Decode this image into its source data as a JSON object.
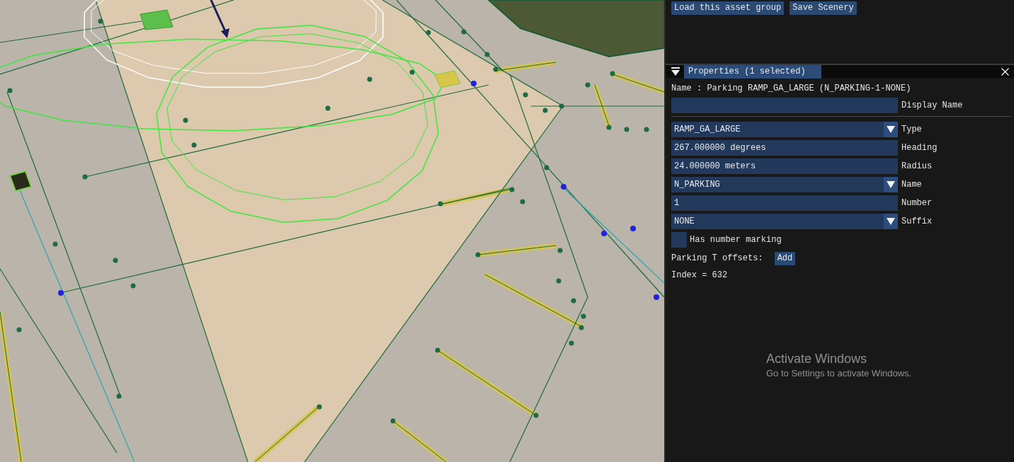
{
  "toolbar": {
    "buttons": [
      "Load this asset group",
      "Save Scenery"
    ]
  },
  "properties": {
    "title": "Properties (1 selected)",
    "expanded": true,
    "name_line": "Name : Parking RAMP_GA_LARGE (N_PARKING-1-NONE)",
    "fields": [
      {
        "kind": "text",
        "label": "Display Name"
      },
      {
        "kind": "combo",
        "value": "RAMP_GA_LARGE",
        "label": "Type"
      },
      {
        "kind": "text",
        "value": "267.000000 degrees",
        "label": "Heading"
      },
      {
        "kind": "text",
        "value": "24.000000 meters",
        "label": "Radius"
      },
      {
        "kind": "combo",
        "value": "N_PARKING",
        "label": "Name"
      },
      {
        "kind": "text",
        "value": "1",
        "label": "Number"
      },
      {
        "kind": "combo",
        "value": "NONE",
        "label": "Suffix"
      }
    ],
    "checkbox": {
      "label": "Has number marking",
      "checked": false
    },
    "offsets": {
      "label": "Parking T offsets:",
      "button": "Add"
    },
    "index": "Index = 632"
  },
  "watermark": {
    "title": "Activate Windows",
    "subtitle": "Go to Settings to activate Windows."
  }
}
